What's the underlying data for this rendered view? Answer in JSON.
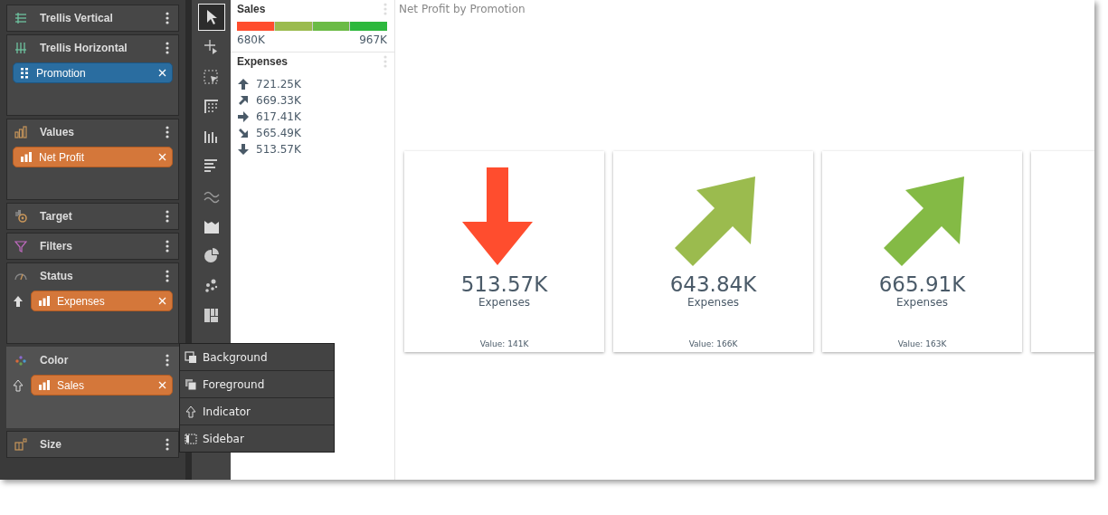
{
  "fields_panel": {
    "sections": [
      {
        "title": "Trellis Vertical",
        "kind": "trellis-vertical",
        "active": false
      },
      {
        "title": "Trellis Horizontal",
        "kind": "trellis-horizontal",
        "active": false,
        "chips": [
          {
            "label": "Promotion",
            "kind": "dimension"
          }
        ]
      },
      {
        "title": "Values",
        "kind": "values",
        "active": false,
        "chips": [
          {
            "label": "Net Profit",
            "kind": "measure"
          }
        ]
      },
      {
        "title": "Target",
        "kind": "target",
        "active": false
      },
      {
        "title": "Filters",
        "kind": "filter",
        "active": false
      },
      {
        "title": "Status",
        "kind": "gauge",
        "active": false,
        "chips": [
          {
            "label": "Expenses",
            "kind": "measure",
            "indicator": {
              "kind": "solid-up"
            }
          }
        ]
      },
      {
        "title": "Color",
        "kind": "dots",
        "active": true,
        "chips": [
          {
            "label": "Sales",
            "kind": "measure",
            "indicator": {
              "kind": "outline-up"
            }
          }
        ]
      },
      {
        "title": "Size",
        "kind": "size",
        "active": false
      }
    ]
  },
  "toolbar": [
    {
      "kind": "pointer",
      "selected": true
    },
    {
      "kind": "crosshair",
      "selected": false
    },
    {
      "kind": "marquee",
      "selected": false
    },
    {
      "kind": "grid",
      "selected": false
    },
    {
      "kind": "columns",
      "selected": false
    },
    {
      "kind": "bars",
      "selected": false
    },
    {
      "kind": "wave",
      "selected": false
    },
    {
      "kind": "area",
      "selected": false
    },
    {
      "kind": "pie",
      "selected": false
    },
    {
      "kind": "scatter",
      "selected": false
    },
    {
      "kind": "treemap",
      "selected": false
    }
  ],
  "popup_menu": {
    "items": [
      {
        "label": "Background",
        "kind": "background"
      },
      {
        "label": "Foreground",
        "kind": "foreground"
      },
      {
        "label": "Indicator",
        "kind": "indicator"
      },
      {
        "label": "Sidebar",
        "kind": "sidebar"
      }
    ]
  },
  "legend": {
    "sales": {
      "title": "Sales",
      "segments": [
        {
          "color": "#ff4d2e"
        },
        {
          "color": "#9bbb4e"
        },
        {
          "color": "#6bbb45"
        },
        {
          "color": "#2db83d"
        }
      ],
      "min": "680K",
      "max": "967K"
    },
    "expenses": {
      "title": "Expenses",
      "items": [
        {
          "kind": "up",
          "value": "721.25K"
        },
        {
          "kind": "up-right",
          "value": "669.33K"
        },
        {
          "kind": "right",
          "value": "617.41K"
        },
        {
          "kind": "down-right",
          "value": "565.49K"
        },
        {
          "kind": "down",
          "value": "513.57K"
        }
      ]
    }
  },
  "chart": {
    "title": "Net Profit by Promotion",
    "cards": [
      {
        "kind": "down",
        "color": "#ff4d2e",
        "value": "513.57K",
        "label": "Expenses",
        "footer": "Value: 141K"
      },
      {
        "kind": "up-right",
        "color": "#9bbb4e",
        "value": "643.84K",
        "label": "Expenses",
        "footer": "Value: 166K"
      },
      {
        "kind": "up-right",
        "color": "#84ba45",
        "value": "665.91K",
        "label": "Expenses",
        "footer": "Value: 163K"
      },
      {
        "kind": "empty"
      }
    ]
  }
}
